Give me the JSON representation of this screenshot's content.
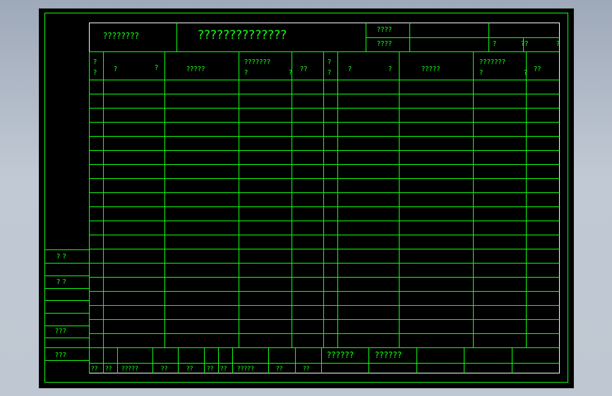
{
  "colors": {
    "line": "#11ff11",
    "frame": "#ffffff",
    "background": "#000000",
    "window": "#b8c1cd"
  },
  "header": {
    "label_left": "????????",
    "title": "??????????????",
    "info_label_1": "????",
    "info_label_2": "????",
    "sheet_q1": "?",
    "sheet_q2": "??",
    "sheet_q3": "?"
  },
  "columns": {
    "left": {
      "idx_a": "?",
      "idx_b": "?",
      "name_a": "?",
      "name_b": "?",
      "spec": "?????",
      "qty_a": "???????",
      "qty_b": "?",
      "qty_c": "?",
      "note": "??"
    },
    "right": {
      "idx_a": "?",
      "idx_b": "?",
      "name_a": "?",
      "name_b": "?",
      "spec": "?????",
      "qty_a": "???????",
      "qty_b": "?",
      "qty_c": "?",
      "note": "??"
    }
  },
  "side": {
    "label_1": "?   ?",
    "label_2": "?   ?",
    "label_3": "???",
    "label_4": "???"
  },
  "footer": {
    "cells": [
      "??",
      "??",
      "?????",
      "??",
      "??",
      "??",
      "??",
      "?????",
      "??",
      "??"
    ],
    "label_a": "??????",
    "label_b": "??????"
  }
}
